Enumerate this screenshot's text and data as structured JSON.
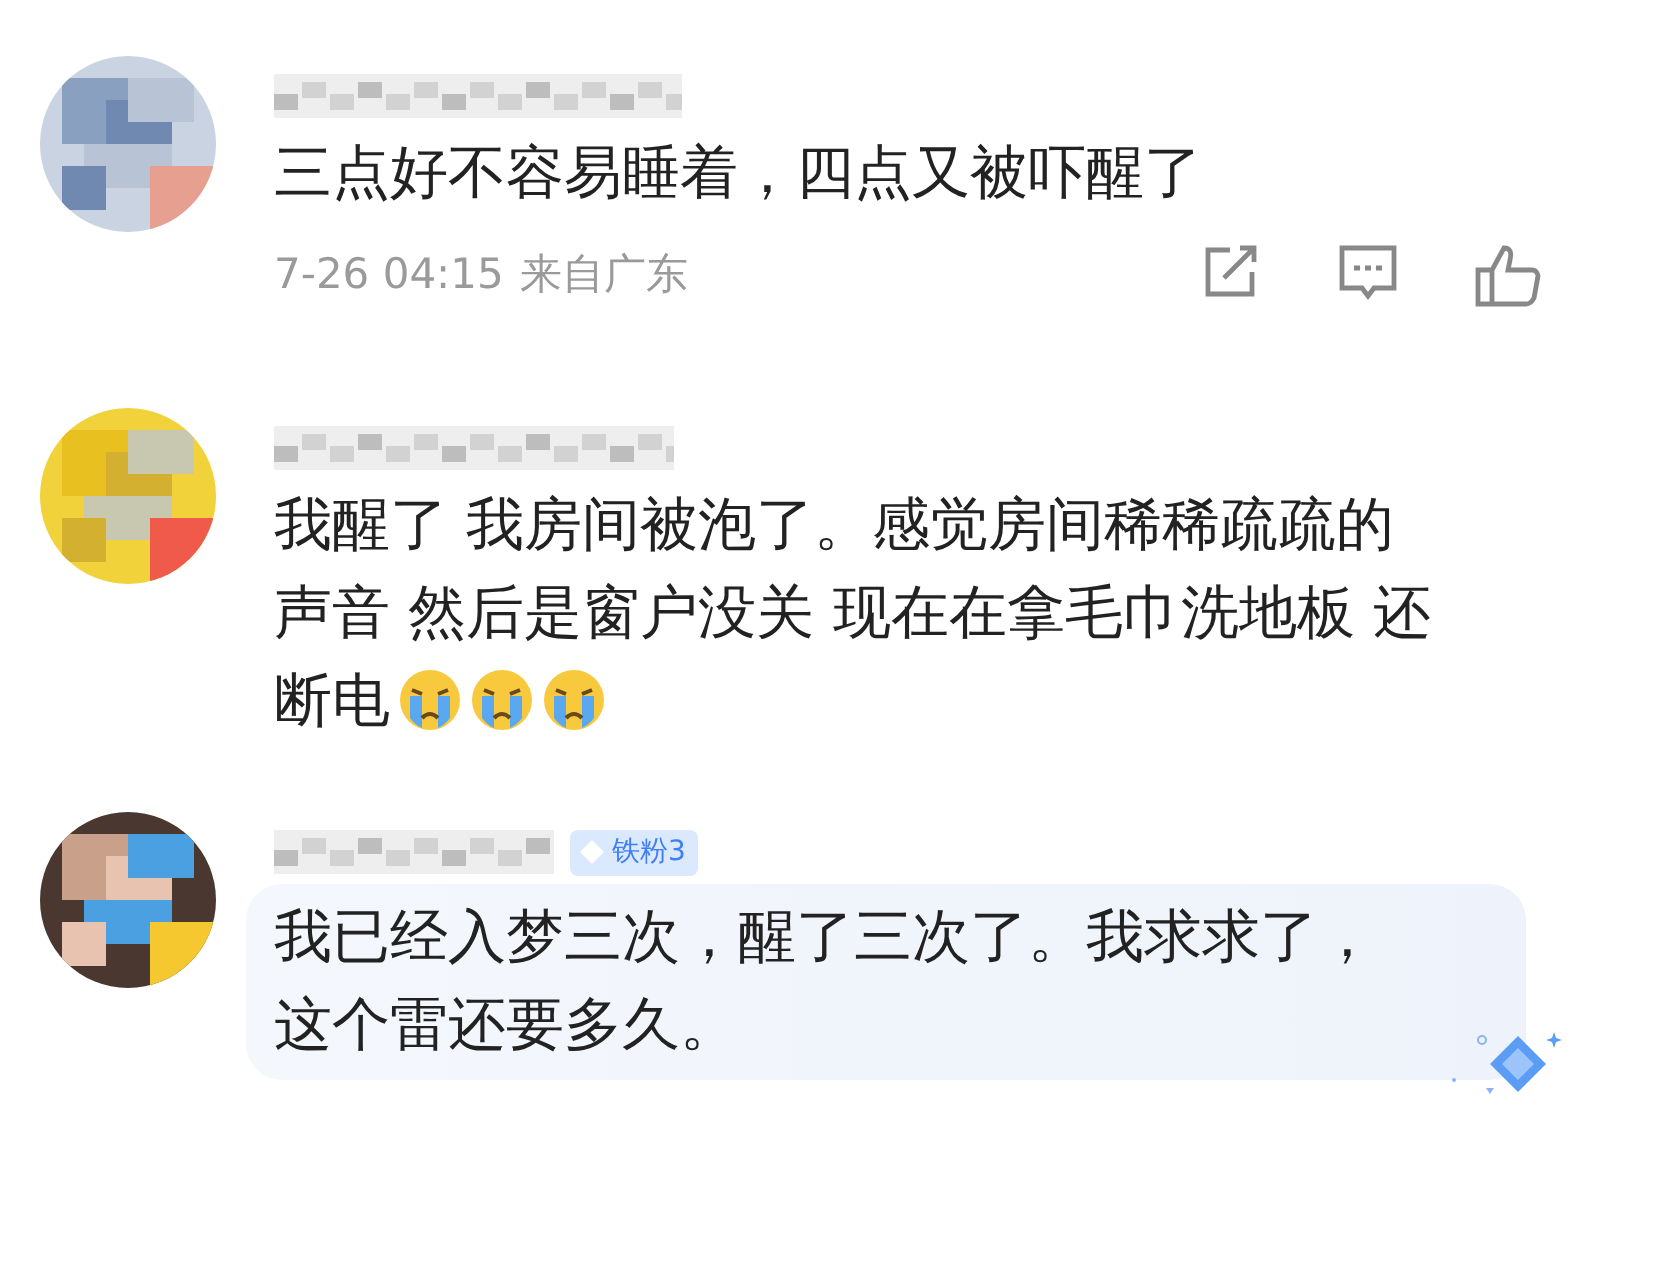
{
  "comments": [
    {
      "text": "三点好不容易睡着，四点又被吓醒了",
      "highlighted": false,
      "meta": {
        "time": "7-26 04:15",
        "location": "来自广东"
      },
      "actions": [
        {
          "kind": "share"
        },
        {
          "kind": "reply"
        },
        {
          "kind": "like"
        }
      ]
    },
    {
      "text": "我醒了 我房间被泡了。感觉房间稀稀疏疏的声音 然后是窗户没关 现在在拿毛巾洗地板 还断电",
      "emojis": [
        {
          "kind": "crying"
        },
        {
          "kind": "crying"
        },
        {
          "kind": "crying"
        }
      ],
      "highlighted": false
    },
    {
      "badge": "铁粉3",
      "text": "我已经入梦三次，醒了三次了。我求求了，这个雷还要多久。",
      "highlighted": true
    }
  ]
}
